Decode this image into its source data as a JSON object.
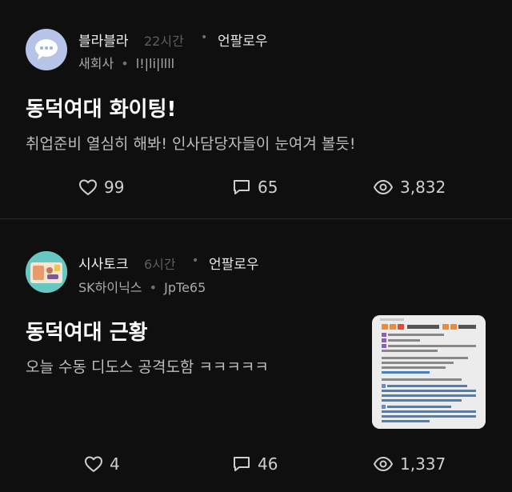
{
  "posts": [
    {
      "topic": "블라블라",
      "time": "22시간",
      "dot": "•",
      "unfollow": "언팔로우",
      "company": "새회사",
      "nickname": "l!|li|llll",
      "title": "동덕여대 화이팅!",
      "body": "취업준비 열심히 해봐! 인사담당자들이 눈여겨 볼듯!",
      "likes": "99",
      "comments": "65",
      "views": "3,832"
    },
    {
      "topic": "시사토크",
      "time": "6시간",
      "dot": "•",
      "unfollow": "언팔로우",
      "company": "SK하이닉스",
      "nickname": "JpTe65",
      "title": "동덕여대 근황",
      "body": "오늘 수동 디도스 공격도함 ㅋㅋㅋㅋㅋ",
      "likes": "4",
      "comments": "46",
      "views": "1,337"
    }
  ],
  "colors": {
    "background": "#0f0f0f",
    "divider": "#2a2a2a",
    "avatar1": "#b6c4e8",
    "avatar2": "#67c7c3"
  },
  "icons": [
    "speech-bubble-icon",
    "heart-icon",
    "comment-icon",
    "eye-icon"
  ]
}
